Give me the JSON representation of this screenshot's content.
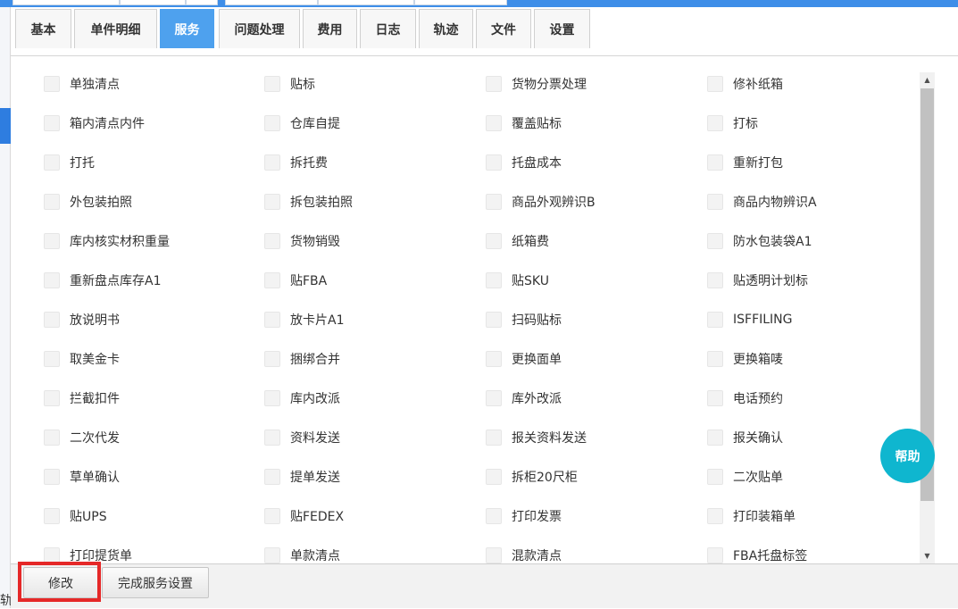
{
  "tabs": [
    {
      "label": "基本",
      "active": false
    },
    {
      "label": "单件明细",
      "active": false
    },
    {
      "label": "服务",
      "active": true
    },
    {
      "label": "问题处理",
      "active": false
    },
    {
      "label": "费用",
      "active": false
    },
    {
      "label": "日志",
      "active": false
    },
    {
      "label": "轨迹",
      "active": false
    },
    {
      "label": "文件",
      "active": false
    },
    {
      "label": "设置",
      "active": false
    }
  ],
  "services": [
    [
      "单独清点",
      "贴标",
      "货物分票处理",
      "修补纸箱"
    ],
    [
      "箱内清点内件",
      "仓库自提",
      "覆盖贴标",
      "打标"
    ],
    [
      "打托",
      "拆托费",
      "托盘成本",
      "重新打包"
    ],
    [
      "外包装拍照",
      "拆包装拍照",
      "商品外观辨识B",
      "商品内物辨识A"
    ],
    [
      "库内核实材积重量",
      "货物销毁",
      "纸箱费",
      "防水包装袋A1"
    ],
    [
      "重新盘点库存A1",
      "贴FBA",
      "贴SKU",
      "贴透明计划标"
    ],
    [
      "放说明书",
      "放卡片A1",
      "扫码贴标",
      "ISFFILING"
    ],
    [
      "取美金卡",
      "捆绑合并",
      "更换面单",
      "更换箱唛"
    ],
    [
      "拦截扣件",
      "库内改派",
      "库外改派",
      "电话预约"
    ],
    [
      "二次代发",
      "资料发送",
      "报关资料发送",
      "报关确认"
    ],
    [
      "草单确认",
      "提单发送",
      "拆柜20尺柜",
      "二次贴单"
    ],
    [
      "贴UPS",
      "贴FEDEX",
      "打印发票",
      "打印装箱单"
    ],
    [
      "打印提货单",
      "单款清点",
      "混款清点",
      "FBA托盘标签"
    ]
  ],
  "help_label": "帮助",
  "footer": {
    "edit_label": "修改",
    "finish_label": "完成服务设置"
  },
  "left_cutoff_text": "轨",
  "colors": {
    "accent": "#4ea1ee",
    "help": "#0fb6cf",
    "highlight": "#e52828"
  },
  "icons": {
    "scroll_up": "▲",
    "scroll_down": "▼"
  }
}
